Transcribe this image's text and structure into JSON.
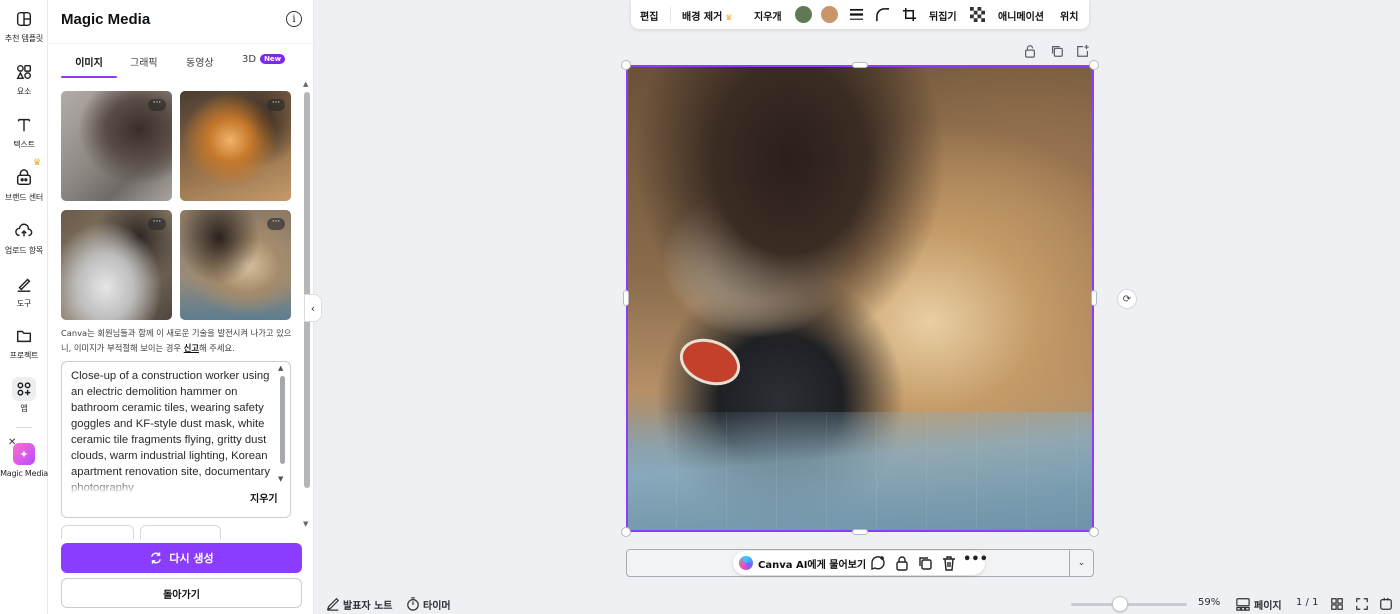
{
  "rail": {
    "items": [
      {
        "label": "추천 템플릿",
        "icon": "template-icon"
      },
      {
        "label": "요소",
        "icon": "elements-icon"
      },
      {
        "label": "텍스트",
        "icon": "text-icon"
      },
      {
        "label": "브랜드 센터",
        "icon": "brand-icon"
      },
      {
        "label": "업로드 항목",
        "icon": "upload-icon"
      },
      {
        "label": "도구",
        "icon": "draw-icon"
      },
      {
        "label": "프로젝트",
        "icon": "folder-icon"
      },
      {
        "label": "앱",
        "icon": "apps-icon"
      },
      {
        "label": "Magic Media",
        "icon": "magic-media-icon"
      }
    ]
  },
  "panel": {
    "title": "Magic Media",
    "tabs": [
      {
        "label": "이미지",
        "active": true
      },
      {
        "label": "그래픽",
        "active": false
      },
      {
        "label": "동영상",
        "active": false
      },
      {
        "label": "3D",
        "active": false,
        "badge": "New"
      }
    ],
    "notice_pre": "Canva는 회원님들과 함께 이 새로운 기술을 발전시켜 나가고 있으니, 이미지가 부적절해 보이는 경우 ",
    "notice_link": "신고",
    "notice_post": "해 주세요.",
    "prompt": "Close-up of a construction worker using an electric demolition hammer on bathroom ceramic tiles, wearing safety goggles and KF-style dust mask, white ceramic tile fragments flying, gritty dust clouds, warm industrial lighting, Korean apartment renovation site,",
    "prompt_overflow": "documentary photography",
    "clear_label": "지우기",
    "regenerate_label": "다시 생성",
    "back_label": "돌아가기",
    "thumb_more": "···"
  },
  "toolbar": {
    "edit": "편집",
    "bg_remove": "배경 제거",
    "erase": "지우개",
    "color1": "#5f7a52",
    "color2": "#c9956a",
    "flip": "뒤집기",
    "animate": "애니메이션",
    "position": "위치"
  },
  "canvas": {
    "ai_prompt": "Canva AI에게 물어보기"
  },
  "footer": {
    "notes": "발표자 노트",
    "timer": "타이머",
    "zoom": "59%",
    "zoom_level": 0.42,
    "pages_label": "페이지",
    "page_count": "1 / 1"
  },
  "colors": {
    "accent": "#8b3dff",
    "crown": "#f5a623"
  }
}
